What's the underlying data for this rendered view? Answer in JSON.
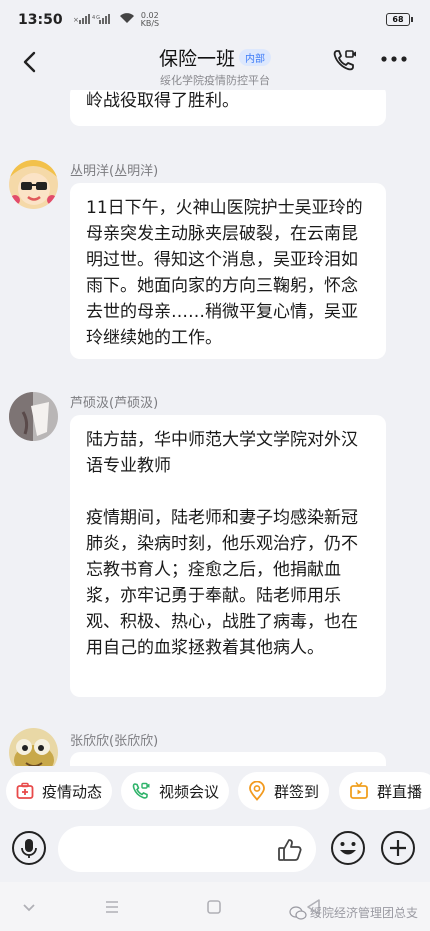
{
  "status_bar": {
    "time": "13:50",
    "signal": "4G",
    "net_speed_value": "0.02",
    "net_speed_unit": "KB/S",
    "battery": "68"
  },
  "header": {
    "title": "保险一班",
    "badge": "内部",
    "subtitle": "绥化学院疫情防控平台"
  },
  "messages": [
    {
      "sender": "",
      "lines": [
        "岭战役取得了胜利。"
      ]
    },
    {
      "sender": "丛明洋(丛明洋)",
      "lines": [
        "11日下午，火神山医院护士吴亚玲的母亲突发主动脉夹层破裂，在云南昆明过世。得知这个消息，吴亚玲泪如雨下。她面向家的方向三鞠躬，怀念去世的母亲……稍微平复心情，吴亚玲继续她的工作。"
      ]
    },
    {
      "sender": "芦硕汲(芦硕汲)",
      "lines": [
        "陆方喆，华中师范大学文学院对外汉语专业教师",
        "疫情期间，陆老师和妻子均感染新冠肺炎，染病时刻，他乐观治疗，仍不忘教书育人；痊愈之后，他捐献血浆，亦牢记勇于奉献。陆老师用乐观、积极、热心，战胜了病毒，也在用自己的血浆拯救着其他病人。"
      ]
    },
    {
      "sender": "张欣欣(张欣欣)",
      "lines": [
        ""
      ]
    }
  ],
  "quick_actions": [
    {
      "label": "疫情动态",
      "icon": "medical-kit-icon"
    },
    {
      "label": "视频会议",
      "icon": "video-call-icon"
    },
    {
      "label": "群签到",
      "icon": "location-pin-icon"
    },
    {
      "label": "群直播",
      "icon": "live-tv-icon"
    }
  ],
  "watermark": "绥院经济管理团总支",
  "colors": {
    "accent_blue": "#3d7bf7",
    "red_icon": "#e84a4a",
    "green_icon": "#2fb36a",
    "orange_icon": "#f29a1f",
    "amber_icon": "#f0a020"
  }
}
